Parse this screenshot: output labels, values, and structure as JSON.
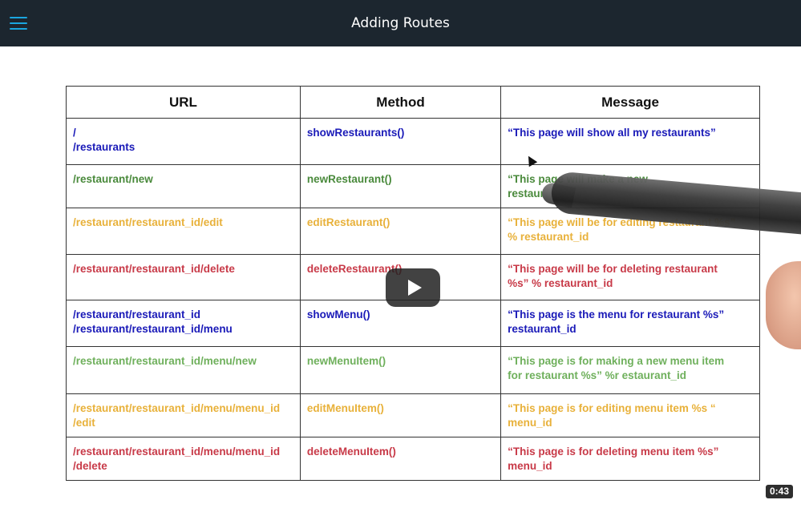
{
  "header": {
    "title": "Adding Routes",
    "menu_icon": "hamburger-menu-icon"
  },
  "colors": {
    "header_bg": "#1c262f",
    "menu_icon": "#1aa6e0",
    "blue": "#1a1ab8",
    "green": "#4a8a3c",
    "yellow": "#e8b13a",
    "red": "#c83a48",
    "light_green": "#6fb05c"
  },
  "table": {
    "headers": [
      "URL",
      "Method",
      "Message"
    ],
    "rows": [
      {
        "color": "#1a1ab8",
        "url": [
          "/",
          "/restaurants"
        ],
        "method": "showRestaurants()",
        "message": [
          "“This page will show all my restaurants”"
        ]
      },
      {
        "color": "#4a8a3c",
        "url": [
          "/restaurant/new"
        ],
        "method": "newRestaurant()",
        "message": [
          "“This page will make a new",
          "restaurant”"
        ]
      },
      {
        "color": "#e8b13a",
        "url": [
          "/restaurant/restaurant_id/edit"
        ],
        "method": "editRestaurant()",
        "message": [
          "“This page will be for editing restaurant %s”",
          "% restaurant_id"
        ]
      },
      {
        "color": "#c83a48",
        "url": [
          "/restaurant/restaurant_id/delete"
        ],
        "method": "deleteRestaurant()",
        "message": [
          "“This page will be for deleting restaurant",
          "%s” % restaurant_id"
        ]
      },
      {
        "color": "#1a1ab8",
        "url": [
          "/restaurant/restaurant_id",
          "/restaurant/restaurant_id/menu"
        ],
        "method": "showMenu()",
        "message": [
          "“This page is the menu for restaurant %s”",
          "restaurant_id"
        ]
      },
      {
        "color": "#6fb05c",
        "url": [
          "/restaurant/restaurant_id/menu/new"
        ],
        "method": "newMenuItem()",
        "message": [
          "“This page is for making a new menu item",
          "for restaurant %s” %r estaurant_id"
        ]
      },
      {
        "color": "#e8b13a",
        "url": [
          "/restaurant/restaurant_id/menu/menu_id",
          "/edit"
        ],
        "method": "editMenuItem()",
        "message": [
          "“This page is for editing menu item %s “",
          "menu_id"
        ]
      },
      {
        "color": "#c83a48",
        "url": [
          "/restaurant/restaurant_id/menu/menu_id",
          "/delete"
        ],
        "method": "deleteMenuItem()",
        "message": [
          "“This page is for deleting menu item %s”",
          "menu_id"
        ]
      }
    ]
  },
  "video": {
    "play_icon": "play-icon",
    "duration": "0:43"
  }
}
